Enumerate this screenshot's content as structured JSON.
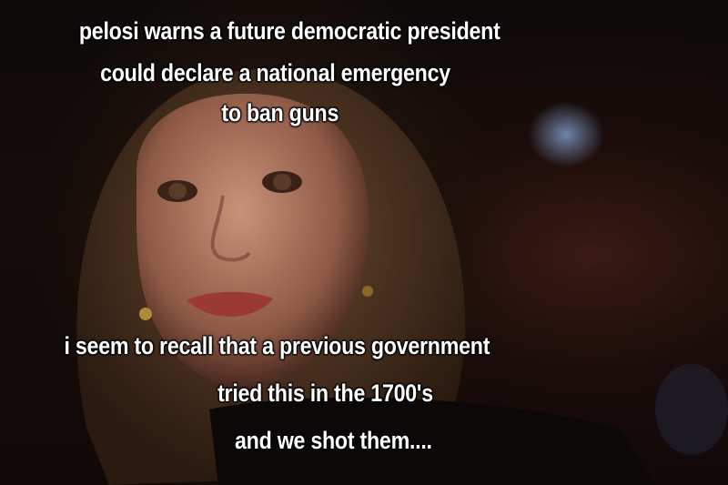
{
  "meme": {
    "top_lines": [
      "pelosi warns a future democratic president",
      "could declare a national emergency",
      "to ban guns"
    ],
    "bottom_lines": [
      "i seem to recall that a previous government",
      "tried this in the 1700's",
      "and we shot them...."
    ]
  }
}
